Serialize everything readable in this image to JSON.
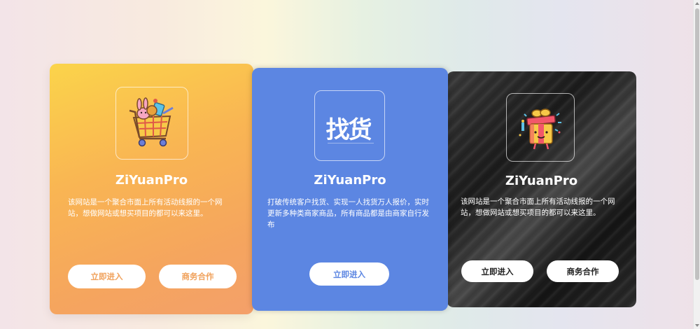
{
  "cards": [
    {
      "icon": "shopping-cart-icon",
      "title": "ZiYuanPro",
      "description": "该网站是一个聚合市面上所有活动线报的一个网站，想做网站或想买项目的都可以来这里。",
      "enter_label": "立即进入",
      "biz_label": "商务合作",
      "accent": "#f0a15b"
    },
    {
      "icon": "zhaohuo-logo-icon",
      "logo_text": "找货",
      "title": "ZiYuanPro",
      "description": "打破传统客户找货、实现一人找货万人报价，实时更新多种类商家商品，所有商品都是由商家自行发布",
      "enter_label": "立即进入",
      "accent": "#5c86e2"
    },
    {
      "icon": "gift-box-icon",
      "title": "ZiYuanPro",
      "description": "该网站是一个聚合市面上所有活动线报的一个网站，想做网站或想买项目的都可以来这里。",
      "enter_label": "立即进入",
      "biz_label": "商务合作",
      "accent": "#222222"
    }
  ]
}
